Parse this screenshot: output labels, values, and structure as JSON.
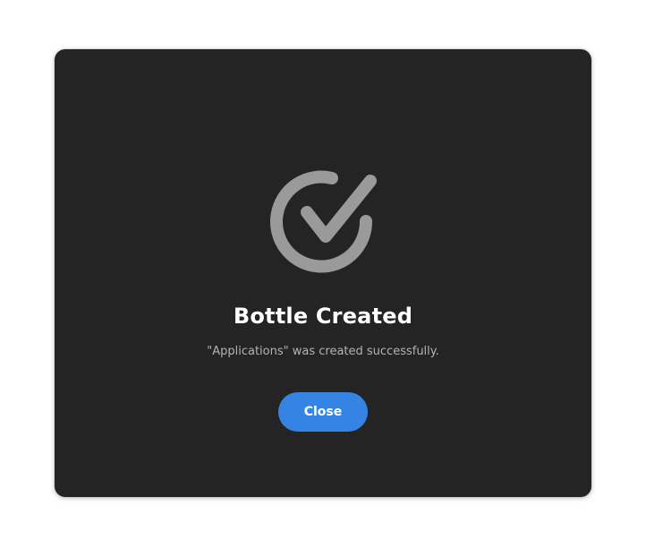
{
  "dialog": {
    "icon": "check-circle-icon",
    "title": "Bottle Created",
    "description": "\"Applications\" was created successfully.",
    "close_label": "Close"
  },
  "colors": {
    "dialog_background": "#242424",
    "page_background": "#ffffff",
    "icon_gray": "#9a9a9a",
    "title_text": "#ffffff",
    "description_text": "#b3b3b3",
    "accent_button": "#3584e4"
  }
}
